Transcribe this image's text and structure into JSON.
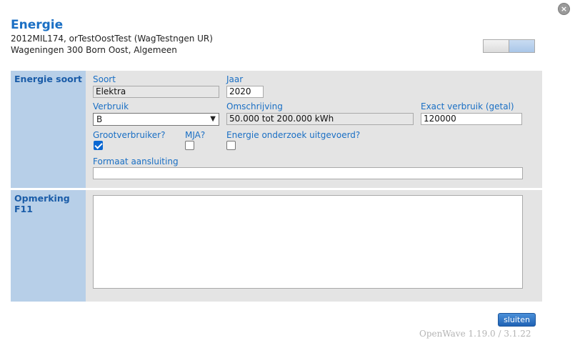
{
  "dialog": {
    "title": "Energie",
    "subtitle_line1": "2012MIL174, orTestOostTest (WagTestngen UR)",
    "subtitle_line2": "Wageningen 300 Born Oost, Algemeen",
    "close_symbol": "×"
  },
  "energie_section": {
    "side_label": "Energie soort",
    "soort": {
      "label": "Soort",
      "value": "Elektra"
    },
    "jaar": {
      "label": "Jaar",
      "value": "2020"
    },
    "verbruik": {
      "label": "Verbruik",
      "selected": "B"
    },
    "omschrijving": {
      "label": "Omschrijving",
      "value": "50.000 tot 200.000 kWh"
    },
    "exact_verbruik": {
      "label": "Exact verbruik (getal)",
      "value": "120000"
    },
    "grootverbruiker": {
      "label": "Grootverbruiker?",
      "checked": true
    },
    "mja": {
      "label": "MJA?",
      "checked": false
    },
    "energie_onderzoek": {
      "label": "Energie onderzoek uitgevoerd?",
      "checked": false
    },
    "formaat_aansluiting": {
      "label": "Formaat aansluiting",
      "value": ""
    }
  },
  "opmerking_section": {
    "side_label": "Opmerking F11",
    "value": ""
  },
  "footer": {
    "close_button_label": "sluiten",
    "version": "OpenWave 1.19.0 / 3.1.22"
  },
  "colors": {
    "accent": "#1a6fc4",
    "panel_bg": "#e4e4e4",
    "side_bg": "#b7cfe8"
  }
}
